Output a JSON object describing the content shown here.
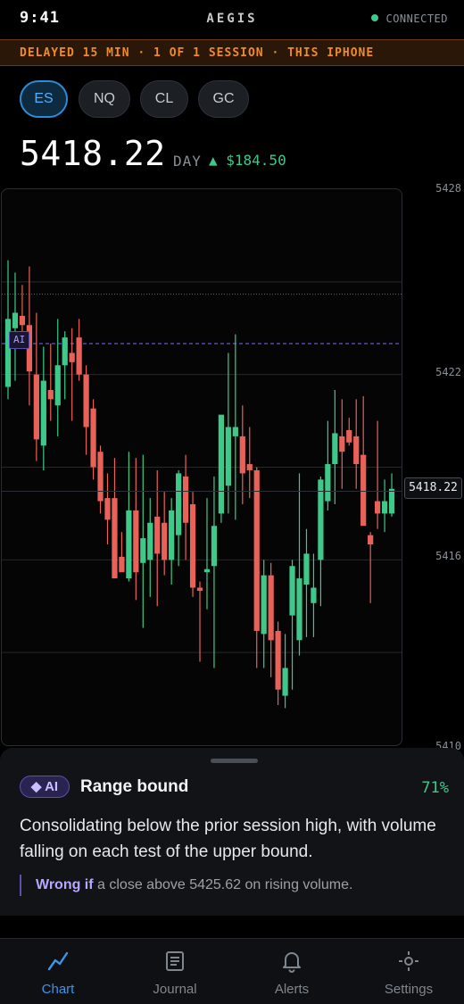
{
  "status_bar": {
    "time": "9:41",
    "connection": "CONNECTED"
  },
  "app": {
    "title": "AEGIS"
  },
  "banner": {
    "text": "DELAYED 15 MIN · 1 OF 1 SESSION · THIS IPHONE"
  },
  "symbols": [
    {
      "label": "ES",
      "active": true
    },
    {
      "label": "NQ",
      "active": false
    },
    {
      "label": "CL",
      "active": false
    },
    {
      "label": "GC",
      "active": false
    }
  ],
  "quote": {
    "price": "5418.22",
    "period_label": "DAY",
    "change": "▲ $184.50"
  },
  "chart": {
    "y_labels": [
      "5428",
      "5422",
      "5416",
      "5410"
    ],
    "last_price_tag": "5418.22",
    "ai_marker": "AI",
    "colors": {
      "up": "#3ec88a",
      "down": "#e8625a",
      "ai_line": "#7b6cff",
      "dotted_line": "#6e6a52"
    }
  },
  "chart_data": {
    "type": "candlestick",
    "ylim": [
      5410,
      5428
    ],
    "y_ticks": [
      5428,
      5422,
      5416,
      5410
    ],
    "last_price": 5418.22,
    "ai_level": 5423.0,
    "dotted_level": 5424.6,
    "grid": true,
    "candles": [
      {
        "o": 5421.6,
        "h": 5425.7,
        "l": 5421.2,
        "c": 5423.8
      },
      {
        "o": 5423.5,
        "h": 5425.3,
        "l": 5421.8,
        "c": 5424.0
      },
      {
        "o": 5423.9,
        "h": 5424.9,
        "l": 5423.3,
        "c": 5423.6
      },
      {
        "o": 5423.6,
        "h": 5425.5,
        "l": 5421.0,
        "c": 5422.1
      },
      {
        "o": 5422.0,
        "h": 5424.0,
        "l": 5419.2,
        "c": 5419.9
      },
      {
        "o": 5419.7,
        "h": 5422.9,
        "l": 5418.9,
        "c": 5421.8
      },
      {
        "o": 5421.5,
        "h": 5423.0,
        "l": 5420.5,
        "c": 5421.2
      },
      {
        "o": 5421.0,
        "h": 5423.8,
        "l": 5420.0,
        "c": 5422.3
      },
      {
        "o": 5422.3,
        "h": 5423.4,
        "l": 5421.2,
        "c": 5423.2
      },
      {
        "o": 5422.7,
        "h": 5423.5,
        "l": 5420.5,
        "c": 5422.4
      },
      {
        "o": 5423.2,
        "h": 5423.8,
        "l": 5421.8,
        "c": 5422.0
      },
      {
        "o": 5422.0,
        "h": 5422.3,
        "l": 5419.4,
        "c": 5420.3
      },
      {
        "o": 5420.9,
        "h": 5421.2,
        "l": 5418.6,
        "c": 5419.0
      },
      {
        "o": 5419.5,
        "h": 5419.7,
        "l": 5417.5,
        "c": 5417.9
      },
      {
        "o": 5418.0,
        "h": 5418.8,
        "l": 5416.5,
        "c": 5417.3
      },
      {
        "o": 5418.0,
        "h": 5419.3,
        "l": 5415.7,
        "c": 5415.4
      },
      {
        "o": 5416.1,
        "h": 5416.9,
        "l": 5415.8,
        "c": 5415.6
      },
      {
        "o": 5415.4,
        "h": 5419.5,
        "l": 5415.3,
        "c": 5417.6
      },
      {
        "o": 5417.6,
        "h": 5419.3,
        "l": 5414.7,
        "c": 5415.6
      },
      {
        "o": 5415.9,
        "h": 5419.4,
        "l": 5413.8,
        "c": 5416.7
      },
      {
        "o": 5416.0,
        "h": 5418.0,
        "l": 5414.8,
        "c": 5417.2
      },
      {
        "o": 5417.4,
        "h": 5418.9,
        "l": 5414.5,
        "c": 5416.2
      },
      {
        "o": 5417.2,
        "h": 5418.2,
        "l": 5415.5,
        "c": 5416.0
      },
      {
        "o": 5416.0,
        "h": 5418.0,
        "l": 5415.2,
        "c": 5417.6
      },
      {
        "o": 5416.8,
        "h": 5418.9,
        "l": 5415.8,
        "c": 5418.8
      },
      {
        "o": 5418.7,
        "h": 5419.4,
        "l": 5416.0,
        "c": 5417.2
      },
      {
        "o": 5417.8,
        "h": 5418.2,
        "l": 5414.8,
        "c": 5415.1
      },
      {
        "o": 5415.1,
        "h": 5415.3,
        "l": 5412.7,
        "c": 5415.0
      },
      {
        "o": 5415.6,
        "h": 5418.0,
        "l": 5414.4,
        "c": 5415.7
      },
      {
        "o": 5415.8,
        "h": 5418.7,
        "l": 5412.5,
        "c": 5417.1
      },
      {
        "o": 5417.5,
        "h": 5420.5,
        "l": 5417.2,
        "c": 5420.7
      },
      {
        "o": 5418.4,
        "h": 5422.7,
        "l": 5417.5,
        "c": 5420.3
      },
      {
        "o": 5420.0,
        "h": 5423.3,
        "l": 5417.3,
        "c": 5420.3
      },
      {
        "o": 5420.0,
        "h": 5421.0,
        "l": 5417.8,
        "c": 5418.8
      },
      {
        "o": 5419.1,
        "h": 5420.3,
        "l": 5418.0,
        "c": 5418.9
      },
      {
        "o": 5418.9,
        "h": 5419.0,
        "l": 5412.5,
        "c": 5413.7
      },
      {
        "o": 5413.6,
        "h": 5416.0,
        "l": 5412.5,
        "c": 5415.5
      },
      {
        "o": 5415.5,
        "h": 5415.9,
        "l": 5412.2,
        "c": 5413.4
      },
      {
        "o": 5413.7,
        "h": 5414.0,
        "l": 5411.3,
        "c": 5411.8
      },
      {
        "o": 5411.6,
        "h": 5413.6,
        "l": 5411.2,
        "c": 5412.5
      },
      {
        "o": 5414.2,
        "h": 5416.0,
        "l": 5411.8,
        "c": 5415.8
      },
      {
        "o": 5413.4,
        "h": 5418.8,
        "l": 5412.9,
        "c": 5415.4
      },
      {
        "o": 5415.2,
        "h": 5417.0,
        "l": 5413.5,
        "c": 5416.2
      },
      {
        "o": 5414.6,
        "h": 5416.2,
        "l": 5413.5,
        "c": 5415.1
      },
      {
        "o": 5416.0,
        "h": 5418.7,
        "l": 5414.5,
        "c": 5418.6
      },
      {
        "o": 5417.9,
        "h": 5420.5,
        "l": 5417.6,
        "c": 5419.1
      },
      {
        "o": 5419.1,
        "h": 5421.5,
        "l": 5417.8,
        "c": 5420.1
      },
      {
        "o": 5420.0,
        "h": 5421.2,
        "l": 5418.3,
        "c": 5419.5
      },
      {
        "o": 5420.2,
        "h": 5420.6,
        "l": 5419.7,
        "c": 5419.8
      },
      {
        "o": 5420.0,
        "h": 5421.2,
        "l": 5418.3,
        "c": 5419.1
      },
      {
        "o": 5419.4,
        "h": 5421.3,
        "l": 5418.2,
        "c": 5417.1
      },
      {
        "o": 5416.8,
        "h": 5416.9,
        "l": 5414.6,
        "c": 5416.5
      },
      {
        "o": 5417.9,
        "h": 5420.5,
        "l": 5417.0,
        "c": 5417.5
      },
      {
        "o": 5417.5,
        "h": 5418.6,
        "l": 5416.9,
        "c": 5417.9
      },
      {
        "o": 5417.5,
        "h": 5418.8,
        "l": 5417.4,
        "c": 5418.3
      }
    ]
  },
  "analysis": {
    "badge": "◆ AI",
    "title": "Range bound",
    "confidence": "71%",
    "summary": "Consolidating below the prior session high, with volume falling on each test of the upper bound.",
    "invalidation_prefix": "Wrong if",
    "invalidation_rest": " a close above 5425.62 on rising volume."
  },
  "tabs": [
    {
      "label": "Chart",
      "active": true,
      "icon": "chart-line-icon"
    },
    {
      "label": "Journal",
      "active": false,
      "icon": "journal-icon"
    },
    {
      "label": "Alerts",
      "active": false,
      "icon": "bell-icon"
    },
    {
      "label": "Settings",
      "active": false,
      "icon": "settings-icon"
    }
  ]
}
